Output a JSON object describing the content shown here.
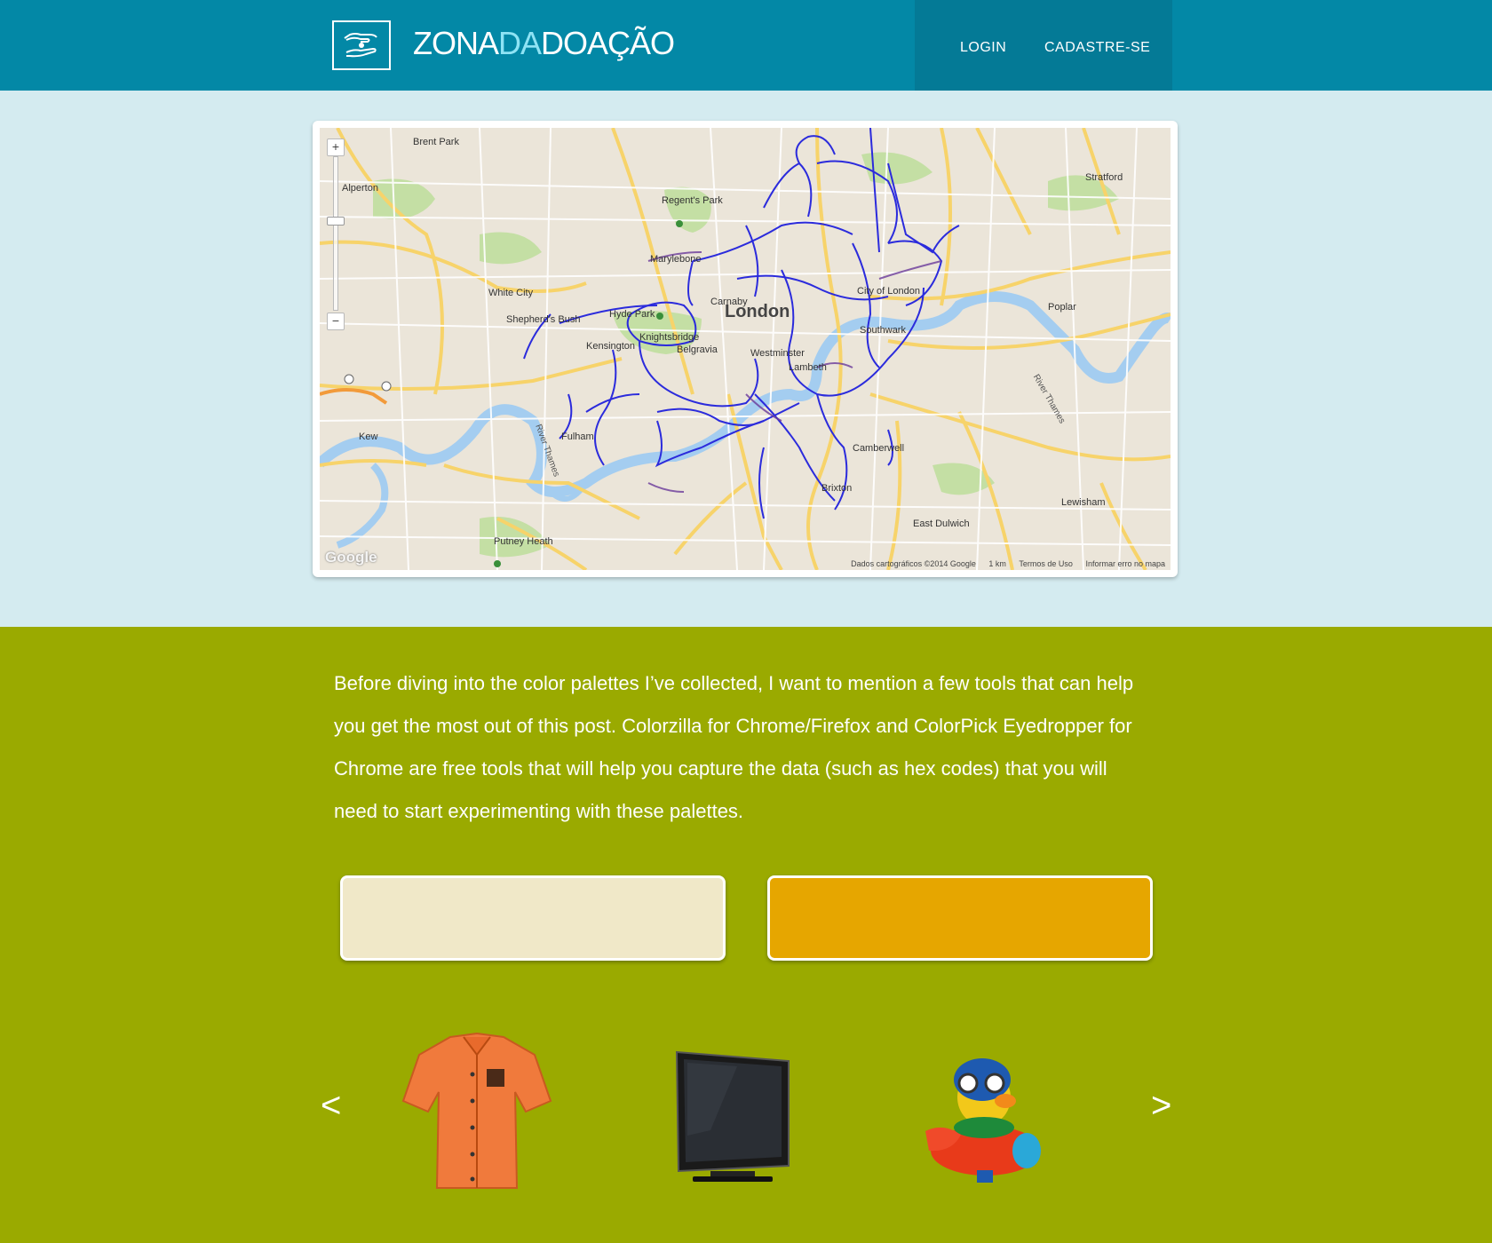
{
  "header": {
    "brand_part1": "ZONA",
    "brand_part2": "DA",
    "brand_part3": "DOAÇÃO",
    "nav": {
      "login": "LOGIN",
      "signup": "CADASTRE-SE"
    },
    "colors": {
      "bar": "#0388a6",
      "nav_bg": "#047a96",
      "brand_accent": "#8ee3f4"
    }
  },
  "map": {
    "city_label": "London",
    "places": [
      "Brent Park",
      "Alperton",
      "Regent's Park",
      "Marylebone",
      "White City",
      "Shepherd's Bush",
      "Hyde Park",
      "Knightsbridge",
      "Kensington",
      "Belgravia",
      "Westminster",
      "Lambeth",
      "City of London",
      "Southwark",
      "Stratford",
      "Poplar",
      "Camberwell",
      "Brixton",
      "Fulham",
      "Putney Heath",
      "Kew",
      "East Dulwich",
      "Lewisham",
      "Carnaby"
    ],
    "rivers": [
      "River Thames"
    ],
    "attribution": "Dados cartográficos ©2014 Google",
    "scale": "1 km",
    "terms": "Termos de Uso",
    "report": "Informar erro no mapa",
    "logo": "Google",
    "zoom_in": "+",
    "zoom_out": "−"
  },
  "intro_text": "Before diving into the color palettes I’ve collected, I want to mention a few tools that can help you get the most out of this post. Colorzilla for Chrome/Firefox and ColorPick Eyedropper for Chrome are free tools that will help you capture the data (such as hex codes) that you will need to start experimenting with these palettes.",
  "palettes": [
    {
      "color": "#f0e8c8"
    },
    {
      "color": "#e6a600"
    }
  ],
  "carousel": {
    "prev": "<",
    "next": ">",
    "items": [
      "shirt-icon",
      "tv-icon",
      "toy-plane-icon"
    ]
  },
  "colors": {
    "green_bg": "#9aaa00",
    "map_section_bg": "#d4ebf0"
  }
}
